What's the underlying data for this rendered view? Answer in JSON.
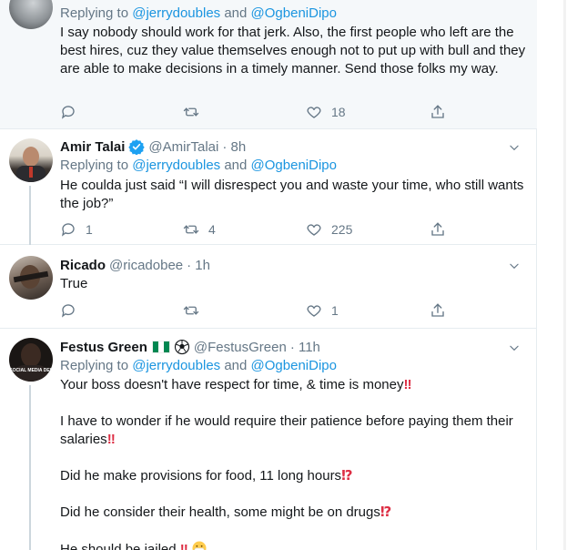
{
  "replying_label": "Replying to",
  "and_label": "and",
  "tweets": [
    {
      "reply_to": [
        "@jerrydoubles",
        "@OgbeniDipo"
      ],
      "text": "I say nobody should work for that jerk. Also, the first people who left are the best hires, cuz they value themselves enough not to put up with bull and they are able to make decisions in a timely manner. Send those folks my way.",
      "replies": "",
      "retweets": "",
      "likes": "18"
    },
    {
      "name": "Amir Talai",
      "handle": "@AmirTalai",
      "time": "· 8h",
      "reply_to": [
        "@jerrydoubles",
        "@OgbeniDipo"
      ],
      "text": "He coulda just said “I will disrespect you and waste your time, who still wants the job?”",
      "replies": "1",
      "retweets": "4",
      "likes": "225"
    },
    {
      "name": "Ricado",
      "handle": "@ricadobee",
      "time": "· 1h",
      "text": "True",
      "replies": "",
      "retweets": "",
      "likes": "1"
    },
    {
      "name": "Festus Green",
      "handle": "@FestusGreen",
      "time": "· 11h",
      "reply_to": [
        "@jerrydoubles",
        "@OgbeniDipo"
      ],
      "lines": [
        "Your boss doesn't have respect for time, & time is money",
        "I have to wonder if he would require their patience before paying them their salaries",
        "Did he make provisions for food, 11 long hours",
        "Did he consider their health, some might be on drugs",
        "He should be jailed"
      ],
      "emojis": [
        "‼",
        "‼",
        "⁉",
        "⁉",
        "‼"
      ],
      "avatar_text": "SOCIAL MEDIA DEL"
    }
  ],
  "colors": {
    "link": "#1b95e0",
    "secondary": "#657786",
    "border": "#e6ecf0",
    "verified": "#1da1f2",
    "emoji_red": "#dd2e44"
  }
}
